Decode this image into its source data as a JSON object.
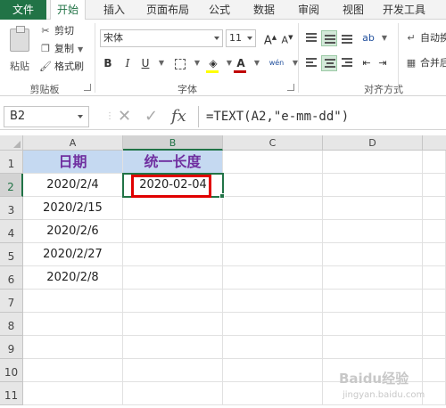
{
  "ribbon_tabs": [
    "文件",
    "开始",
    "插入",
    "页面布局",
    "公式",
    "数据",
    "审阅",
    "视图",
    "开发工具"
  ],
  "clipboard": {
    "paste_label": "粘贴",
    "cut_label": "剪切",
    "copy_label": "复制",
    "format_painter_label": "格式刷",
    "group_label": "剪贴板"
  },
  "font": {
    "font_name": "宋体",
    "font_size": "11",
    "grow_label": "A",
    "shrink_label": "A",
    "bold": "B",
    "italic": "I",
    "underline": "U",
    "font_color_label": "A",
    "phonetic_label": "wén",
    "group_label": "字体",
    "font_color": "#c00000",
    "fill_color": "#ffff00"
  },
  "alignment": {
    "wrap_label": "自动换",
    "merge_label": "合并后",
    "group_label": "对齐方式"
  },
  "formula_bar": {
    "name_box": "B2",
    "fx_label": "fx",
    "formula": "=TEXT(A2,\"e-mm-dd\")"
  },
  "grid": {
    "columns": [
      "A",
      "B",
      "C",
      "D"
    ],
    "selected_column": "B",
    "rows": [
      "1",
      "2",
      "3",
      "4",
      "5",
      "6",
      "7",
      "8",
      "9",
      "10",
      "11"
    ],
    "selected_row": "2",
    "header_row": [
      "日期",
      "统一长度"
    ],
    "col_a_dates": [
      "2020/2/4",
      "2020/2/15",
      "2020/2/6",
      "2020/2/27",
      "2020/2/8"
    ],
    "b2_value": "2020-02-04",
    "header_fill": "#c5d9f1",
    "header_text_color": "#7030a0",
    "highlight_color": "#e00000"
  },
  "watermark": {
    "top": "Baidu经验",
    "bottom": "jingyan.baidu.com"
  }
}
